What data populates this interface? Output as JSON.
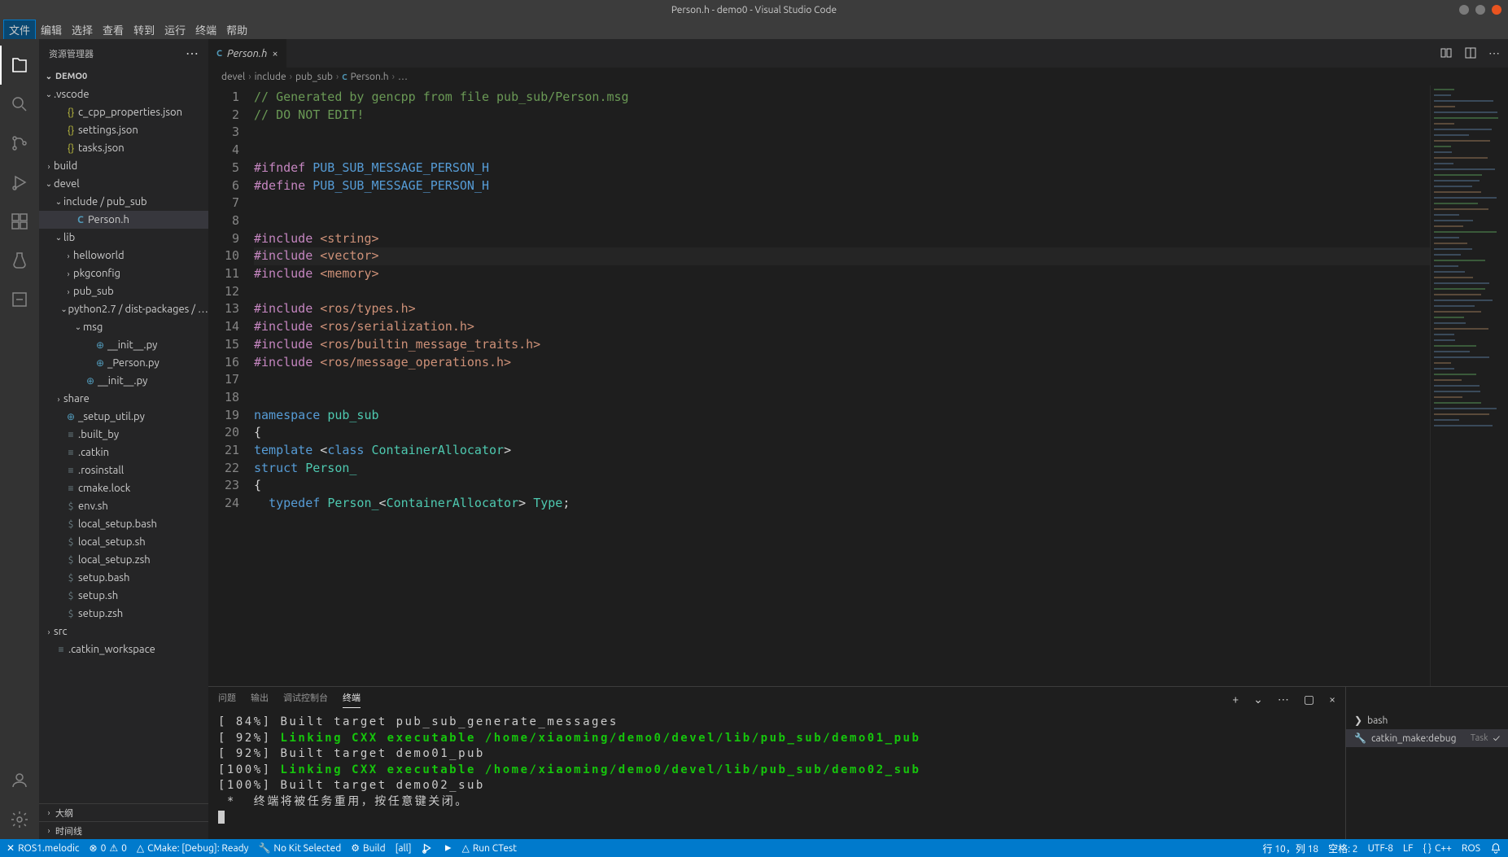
{
  "titlebar": {
    "text": "Person.h - demo0 - Visual Studio Code"
  },
  "menu": {
    "items": [
      "文件",
      "编辑",
      "选择",
      "查看",
      "转到",
      "运行",
      "终端",
      "帮助"
    ]
  },
  "sidebar": {
    "title": "资源管理器",
    "project": "DEMO0",
    "outline": "大纲",
    "timeline": "时间线",
    "tree": [
      {
        "d": 0,
        "t": "folder",
        "open": true,
        "label": ".vscode"
      },
      {
        "d": 1,
        "t": "json",
        "label": "c_cpp_properties.json"
      },
      {
        "d": 1,
        "t": "json",
        "label": "settings.json"
      },
      {
        "d": 1,
        "t": "json",
        "label": "tasks.json"
      },
      {
        "d": 0,
        "t": "folder",
        "open": false,
        "label": "build"
      },
      {
        "d": 0,
        "t": "folder",
        "open": true,
        "label": "devel"
      },
      {
        "d": 1,
        "t": "folder",
        "open": true,
        "label": "include / pub_sub"
      },
      {
        "d": 2,
        "t": "c",
        "label": "Person.h",
        "selected": true
      },
      {
        "d": 1,
        "t": "folder",
        "open": true,
        "label": "lib"
      },
      {
        "d": 2,
        "t": "folder",
        "open": false,
        "label": "helloworld"
      },
      {
        "d": 2,
        "t": "folder",
        "open": false,
        "label": "pkgconfig"
      },
      {
        "d": 2,
        "t": "folder",
        "open": false,
        "label": "pub_sub"
      },
      {
        "d": 2,
        "t": "folder",
        "open": true,
        "label": "python2.7 / dist-packages / …"
      },
      {
        "d": 3,
        "t": "folder",
        "open": true,
        "label": "msg"
      },
      {
        "d": 4,
        "t": "py",
        "label": "__init__.py"
      },
      {
        "d": 4,
        "t": "py",
        "label": "_Person.py"
      },
      {
        "d": 3,
        "t": "py",
        "label": "__init__.py"
      },
      {
        "d": 1,
        "t": "folder",
        "open": false,
        "label": "share"
      },
      {
        "d": 1,
        "t": "py",
        "label": "_setup_util.py"
      },
      {
        "d": 1,
        "t": "file",
        "label": ".built_by"
      },
      {
        "d": 1,
        "t": "file",
        "label": ".catkin"
      },
      {
        "d": 1,
        "t": "file",
        "label": ".rosinstall"
      },
      {
        "d": 1,
        "t": "file",
        "label": "cmake.lock"
      },
      {
        "d": 1,
        "t": "sh",
        "label": "env.sh"
      },
      {
        "d": 1,
        "t": "sh",
        "label": "local_setup.bash"
      },
      {
        "d": 1,
        "t": "sh",
        "label": "local_setup.sh"
      },
      {
        "d": 1,
        "t": "sh",
        "label": "local_setup.zsh"
      },
      {
        "d": 1,
        "t": "sh",
        "label": "setup.bash"
      },
      {
        "d": 1,
        "t": "sh",
        "label": "setup.sh"
      },
      {
        "d": 1,
        "t": "sh",
        "label": "setup.zsh"
      },
      {
        "d": 0,
        "t": "folder",
        "open": false,
        "label": "src"
      },
      {
        "d": 0,
        "t": "file",
        "label": ".catkin_workspace"
      }
    ]
  },
  "tab": {
    "filename": "Person.h"
  },
  "breadcrumbs": [
    "devel",
    "include",
    "pub_sub",
    "Person.h",
    "…"
  ],
  "code": {
    "lines": [
      {
        "n": 1,
        "html": "<span class='cm'>// Generated by gencpp from file pub_sub/Person.msg</span>"
      },
      {
        "n": 2,
        "html": "<span class='cm'>// DO NOT EDIT!</span>"
      },
      {
        "n": 3,
        "html": ""
      },
      {
        "n": 4,
        "html": ""
      },
      {
        "n": 5,
        "html": "<span class='inc'>#ifndef</span> <span class='def'>PUB_SUB_MESSAGE_PERSON_H</span>"
      },
      {
        "n": 6,
        "html": "<span class='inc'>#define</span> <span class='def'>PUB_SUB_MESSAGE_PERSON_H</span>"
      },
      {
        "n": 7,
        "html": ""
      },
      {
        "n": 8,
        "html": ""
      },
      {
        "n": 9,
        "html": "<span class='inc'>#include</span> <span class='hdr'>&lt;string&gt;</span>"
      },
      {
        "n": 10,
        "html": "<span class='inc'>#include</span> <span class='hdr'>&lt;vector&gt;</span>",
        "cursor": true
      },
      {
        "n": 11,
        "html": "<span class='inc'>#include</span> <span class='hdr'>&lt;memory&gt;</span>"
      },
      {
        "n": 12,
        "html": ""
      },
      {
        "n": 13,
        "html": "<span class='inc'>#include</span> <span class='hdr'>&lt;ros/types.h&gt;</span>"
      },
      {
        "n": 14,
        "html": "<span class='inc'>#include</span> <span class='hdr'>&lt;ros/serialization.h&gt;</span>"
      },
      {
        "n": 15,
        "html": "<span class='inc'>#include</span> <span class='hdr'>&lt;ros/builtin_message_traits.h&gt;</span>"
      },
      {
        "n": 16,
        "html": "<span class='inc'>#include</span> <span class='hdr'>&lt;ros/message_operations.h&gt;</span>"
      },
      {
        "n": 17,
        "html": ""
      },
      {
        "n": 18,
        "html": ""
      },
      {
        "n": 19,
        "html": "<span class='def'>namespace</span> <span class='ns'>pub_sub</span>"
      },
      {
        "n": 20,
        "html": "<span class='pun'>{</span>"
      },
      {
        "n": 21,
        "html": "<span class='def'>template</span> <span class='pun'>&lt;</span><span class='def'>class</span> <span class='type'>ContainerAllocator</span><span class='pun'>&gt;</span>"
      },
      {
        "n": 22,
        "html": "<span class='def'>struct</span> <span class='type'>Person_</span>"
      },
      {
        "n": 23,
        "html": "<span class='pun'>{</span>"
      },
      {
        "n": 24,
        "html": "  <span class='def'>typedef</span> <span class='type'>Person_</span><span class='pun'>&lt;</span><span class='type'>ContainerAllocator</span><span class='pun'>&gt;</span> <span class='type'>Type</span><span class='pun'>;</span>"
      }
    ]
  },
  "panel": {
    "tabs": [
      "问题",
      "输出",
      "调试控制台",
      "终端"
    ],
    "active": 3,
    "terminal_lines": [
      {
        "plain": "[ 84%] Built target pub_sub_generate_messages"
      },
      {
        "pct": "[ 92%] ",
        "green": "Linking CXX executable /home/xiaoming/demo0/devel/lib/pub_sub/demo01_pub"
      },
      {
        "plain": "[ 92%] Built target demo01_pub"
      },
      {
        "pct": "[100%] ",
        "green": "Linking CXX executable /home/xiaoming/demo0/devel/lib/pub_sub/demo02_sub"
      },
      {
        "plain": "[100%] Built target demo02_sub"
      },
      {
        "plain": " *  终端将被任务重用，按任意键关闭。 "
      }
    ],
    "terminals": [
      {
        "icon": "bash",
        "label": "bash"
      },
      {
        "icon": "tool",
        "label": "catkin_make:debug",
        "task": "Task",
        "check": true,
        "active": true
      }
    ]
  },
  "statusbar": {
    "remote": "ROS1.melodic",
    "errors": "0",
    "warnings": "0",
    "cmake": "CMake: [Debug]: Ready",
    "nokit": "No Kit Selected",
    "build": "Build",
    "target": "[all]",
    "runctest": "Run CTest",
    "position": "行 10，列 18",
    "spaces": "空格: 2",
    "encoding": "UTF-8",
    "eol": "LF",
    "lang": "C++",
    "ros": "ROS"
  }
}
